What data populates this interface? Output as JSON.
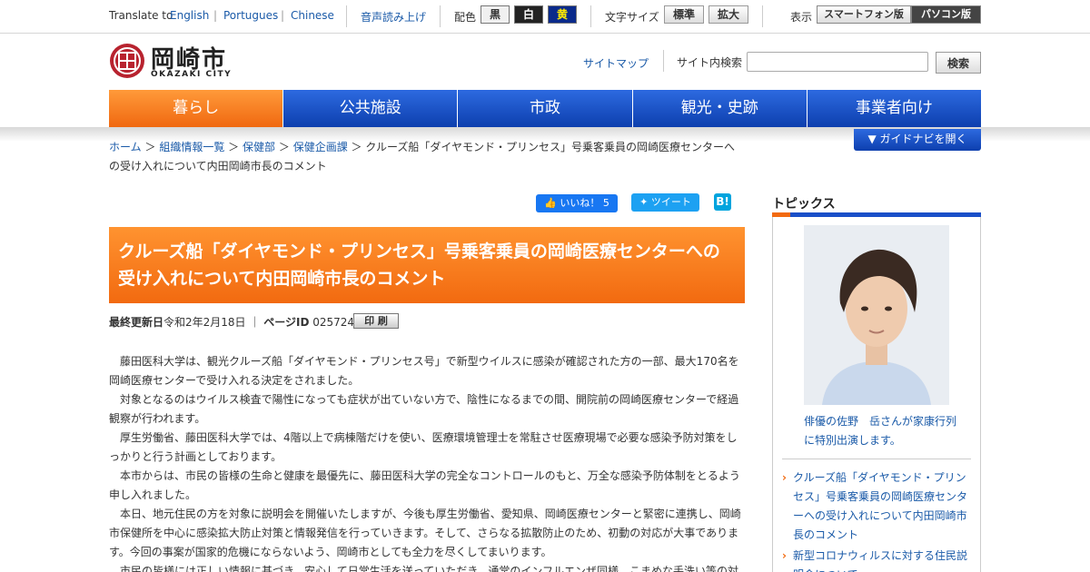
{
  "utility": {
    "translate_label": "Translate to",
    "languages": [
      "English",
      "Portugues",
      "Chinese"
    ],
    "separator": "|",
    "speech_link": "音声読み上げ",
    "color_label": "配色",
    "colors": [
      {
        "label": "黒",
        "bg": "#f0f0f0",
        "fg": "#333333"
      },
      {
        "label": "白",
        "bg": "#222222",
        "fg": "#ffffff"
      },
      {
        "label": "黄",
        "bg": "#0a2a8a",
        "fg": "#ffea00"
      }
    ],
    "font_size_label": "文字サイズ",
    "font_sizes": [
      "標準",
      "拡大"
    ],
    "display_label": "表示",
    "display_options": [
      "スマートフォン版",
      "パソコン版"
    ]
  },
  "header": {
    "logo_text": "岡崎市",
    "logo_sub": "OKAZAKI CITY",
    "sitemap": "サイトマップ",
    "search_label": "サイト内検索",
    "search_button": "検索",
    "search_value": ""
  },
  "nav": {
    "items": [
      "暮らし",
      "公共施設",
      "市政",
      "観光・史跡",
      "事業者向け"
    ],
    "guide_button": "ガイドナビを開く"
  },
  "breadcrumb": {
    "links": [
      "ホーム",
      "組織情報一覧",
      "保健部",
      "保健企画課"
    ],
    "separator": "＞",
    "current": "クルーズ船「ダイヤモンド・プリンセス」号乗客乗員の岡崎医療センターへの受け入れについて内田岡崎市長のコメント"
  },
  "social": {
    "like": "いいね！ 5",
    "tweet": "ツイート",
    "hatena": "B!"
  },
  "article": {
    "title": "クルーズ船「ダイヤモンド・プリンセス」号乗客乗員の岡崎医療センターへの受け入れについて内田岡崎市長のコメント",
    "updated_label": "最終更新日",
    "updated_value": "令和2年2月18日",
    "meta_sep": "｜",
    "page_id_label": "ページID",
    "page_id_value": "025724",
    "print": "印 刷",
    "paragraphs": [
      "藤田医科大学は、観光クルーズ船「ダイヤモンド・プリンセス号」で新型ウイルスに感染が確認された方の一部、最大170名を岡崎医療センターで受け入れる決定をされました。",
      "対象となるのはウイルス検査で陽性になっても症状が出ていない方で、陰性になるまでの間、開院前の岡崎医療センターで経過観察が行われます。",
      "厚生労働省、藤田医科大学では、4階以上で病棟階だけを使い、医療環境管理士を常駐させ医療現場で必要な感染予防対策をしっかりと行う計画としております。",
      "本市からは、市民の皆様の生命と健康を最優先に、藤田医科大学の完全なコントロールのもと、万全な感染予防体制をとるよう申し入れました。",
      "本日、地元住民の方を対象に説明会を開催いたしますが、今後も厚生労働省、愛知県、岡崎医療センターと緊密に連携し、岡崎市保健所を中心に感染拡大防止対策と情報発信を行っていきます。そして、さらなる拡散防止のため、初動の対応が大事でありま す。今回の事案が国家的危機にならないよう、岡崎市としても全力を尽くしてまいります。",
      "市民の皆様には正しい情報に基づき、安心して日常生活を送っていただき、通常のインフルエンザ同様、こまめな手洗い等の対"
    ]
  },
  "sidebar": {
    "heading": "トピックス",
    "caption": "俳優の佐野　岳さんが家康行列に特別出演します。",
    "items": [
      "クルーズ船「ダイヤモンド・プリンセス」号乗客乗員の岡崎医療センターへの受け入れについて内田岡崎市長のコメント",
      "新型コロナウィルスに対する住民説明会について"
    ]
  }
}
